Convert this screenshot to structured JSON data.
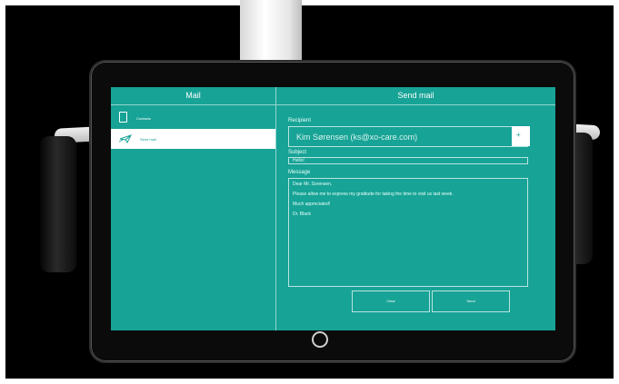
{
  "sidebar": {
    "title": "Mail",
    "items": [
      {
        "label": "Contacts",
        "icon": "phone-icon"
      },
      {
        "label": "Send mail",
        "icon": "paper-plane-icon",
        "active": true
      }
    ]
  },
  "main": {
    "title": "Send mail",
    "recipient_label": "Recipient",
    "recipient_value": "Kim Sørensen (ks@xo-care.com)",
    "add_button_label": "+",
    "subject_label": "Subject",
    "subject_value": "Hello!",
    "message_label": "Message",
    "message_lines": [
      "Dear Mr. Sorensen,",
      "Please allow me to express my gratitude for taking the time to visit us last week.",
      "Much appreciated!",
      "Dr. Black"
    ],
    "clear_label": "Clear",
    "send_label": "Send"
  },
  "colors": {
    "screen": "#17a396",
    "accent": "#ffffff"
  }
}
